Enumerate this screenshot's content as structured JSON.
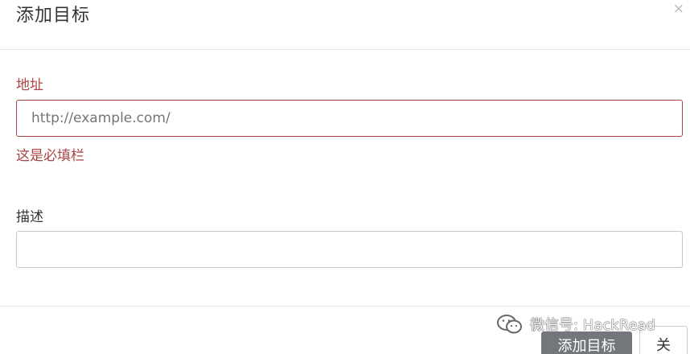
{
  "dialog": {
    "title": "添加目标",
    "close_glyph": "×"
  },
  "form": {
    "address": {
      "label": "地址",
      "placeholder": "http://example.com/",
      "error": "这是必填栏"
    },
    "description": {
      "label": "描述",
      "value": ""
    }
  },
  "footer": {
    "add_button": "添加目标",
    "close_button": "关"
  },
  "watermark": {
    "text": "微信号: HackRead",
    "icon": "wechat-icon"
  },
  "colors": {
    "error": "#a94442",
    "primary_button": "#73777c"
  }
}
